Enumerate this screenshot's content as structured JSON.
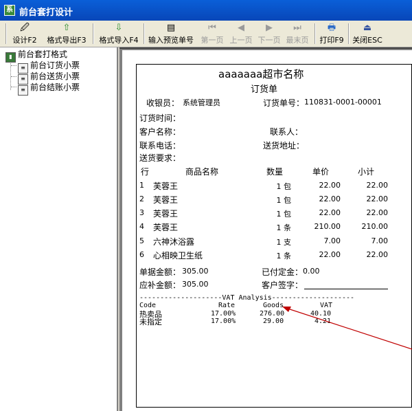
{
  "window": {
    "title": "前台套打设计",
    "app_icon": "app-icon"
  },
  "toolbar": {
    "buttons": [
      {
        "label": "设计F2",
        "icon": "design-icon",
        "enabled": true
      },
      {
        "label": "格式导出F3",
        "icon": "export-icon",
        "enabled": true
      },
      {
        "label": "格式导入F4",
        "icon": "import-icon",
        "enabled": true
      },
      {
        "label": "输入预览单号",
        "icon": "preview-icon",
        "enabled": true
      },
      {
        "label": "第一页",
        "icon": "first-page-icon",
        "enabled": false
      },
      {
        "label": "上一页",
        "icon": "prev-page-icon",
        "enabled": false
      },
      {
        "label": "下一页",
        "icon": "next-page-icon",
        "enabled": false
      },
      {
        "label": "最末页",
        "icon": "last-page-icon",
        "enabled": false
      },
      {
        "label": "打印F9",
        "icon": "printer-icon",
        "enabled": true
      },
      {
        "label": "关闭ESC",
        "icon": "close-icon",
        "enabled": true
      }
    ]
  },
  "tree": {
    "root": "前台套打格式",
    "items": [
      "前台订货小票",
      "前台送货小票",
      "前台结账小票"
    ]
  },
  "receipt": {
    "title": "aaaaaaa超市名称",
    "subtitle": "订货单",
    "cashier_label": "收银员：",
    "cashier_value": "系统管理员",
    "order_no_label": "订货单号：",
    "order_no_value": "110831-0001-00001",
    "order_time_label": "订货时间：",
    "customer_label": "客户名称：",
    "contact_label": "联系人：",
    "phone_label": "联系电话：",
    "address_label": "送货地址：",
    "requirement_label": "送货要求：",
    "columns": [
      "行",
      "商品名称",
      "数量",
      "单价",
      "小计"
    ],
    "rows": [
      {
        "no": "1",
        "name": "芙蓉王",
        "qty": "1 包",
        "price": "22.00",
        "subtotal": "22.00"
      },
      {
        "no": "2",
        "name": "芙蓉王",
        "qty": "1 包",
        "price": "22.00",
        "subtotal": "22.00"
      },
      {
        "no": "3",
        "name": "芙蓉王",
        "qty": "1 包",
        "price": "22.00",
        "subtotal": "22.00"
      },
      {
        "no": "4",
        "name": "芙蓉王",
        "qty": "1 条",
        "price": "210.00",
        "subtotal": "210.00"
      },
      {
        "no": "5",
        "name": "六神沐浴露",
        "qty": "1 支",
        "price": "7.00",
        "subtotal": "7.00"
      },
      {
        "no": "6",
        "name": "心相映卫生纸",
        "qty": "1 条",
        "price": "22.00",
        "subtotal": "22.00"
      }
    ],
    "bill_amount_label": "单据金额：",
    "bill_amount_value": "305.00",
    "deposit_label": "已付定金：",
    "deposit_value": "0.00",
    "due_amount_label": "应补金额：",
    "due_amount_value": "305.00",
    "signature_label": "客户签字：",
    "vat": {
      "header": "--------------------VAT Analysis--------------------",
      "columns": [
        "Code",
        "Rate",
        "Goods",
        "VAT"
      ],
      "rows": [
        {
          "code": "热卖品",
          "rate": "17.00%",
          "goods": "276.00",
          "vat": "40.10"
        },
        {
          "code": "未指定",
          "rate": "17.00%",
          "goods": "29.00",
          "vat": "4.21"
        }
      ]
    }
  },
  "colors": {
    "titlebar": "#0a5fd8",
    "arrow": "#c00000",
    "preview_bg": "#808080"
  }
}
